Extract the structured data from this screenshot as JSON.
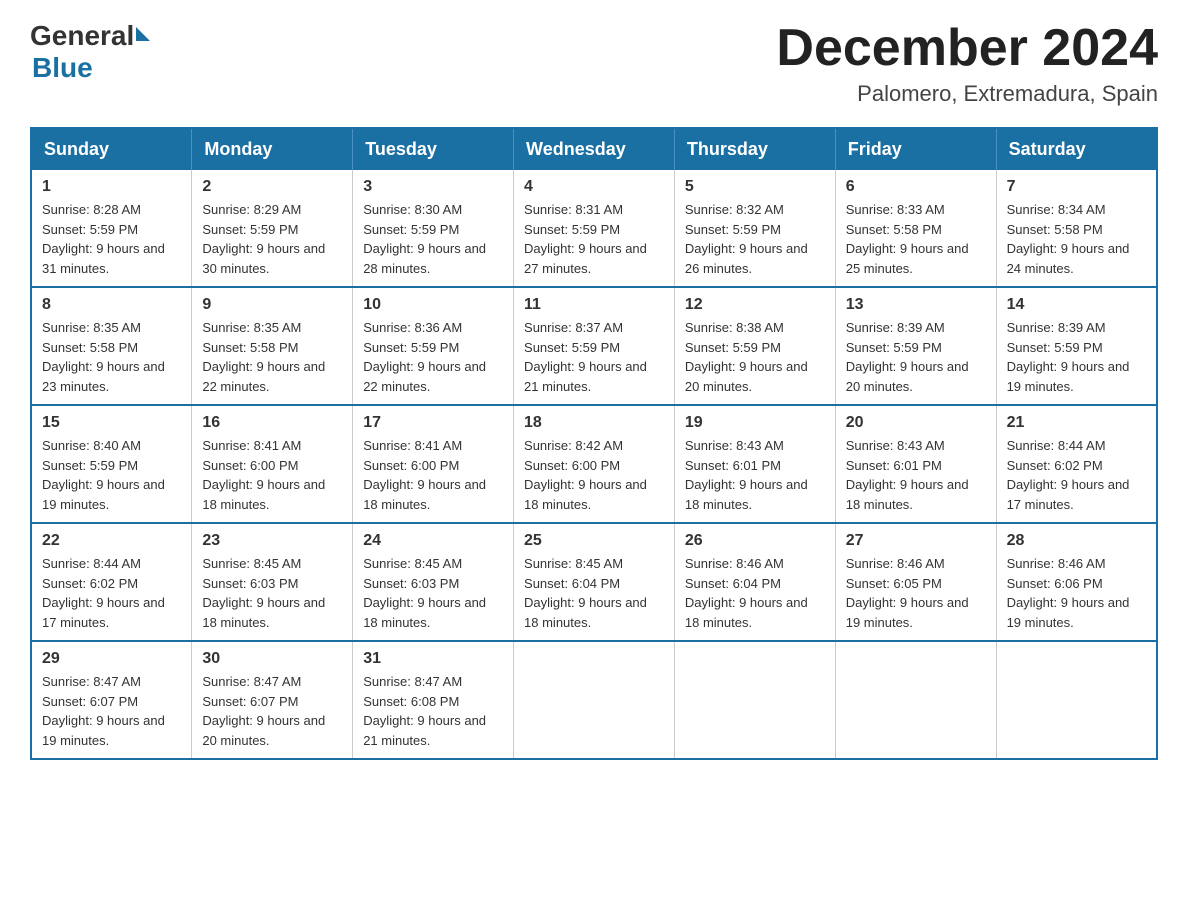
{
  "header": {
    "logo_general": "General",
    "logo_blue": "Blue",
    "month_title": "December 2024",
    "location": "Palomero, Extremadura, Spain"
  },
  "calendar": {
    "headers": [
      "Sunday",
      "Monday",
      "Tuesday",
      "Wednesday",
      "Thursday",
      "Friday",
      "Saturday"
    ],
    "weeks": [
      [
        {
          "day": "1",
          "sunrise": "8:28 AM",
          "sunset": "5:59 PM",
          "daylight": "9 hours and 31 minutes."
        },
        {
          "day": "2",
          "sunrise": "8:29 AM",
          "sunset": "5:59 PM",
          "daylight": "9 hours and 30 minutes."
        },
        {
          "day": "3",
          "sunrise": "8:30 AM",
          "sunset": "5:59 PM",
          "daylight": "9 hours and 28 minutes."
        },
        {
          "day": "4",
          "sunrise": "8:31 AM",
          "sunset": "5:59 PM",
          "daylight": "9 hours and 27 minutes."
        },
        {
          "day": "5",
          "sunrise": "8:32 AM",
          "sunset": "5:59 PM",
          "daylight": "9 hours and 26 minutes."
        },
        {
          "day": "6",
          "sunrise": "8:33 AM",
          "sunset": "5:58 PM",
          "daylight": "9 hours and 25 minutes."
        },
        {
          "day": "7",
          "sunrise": "8:34 AM",
          "sunset": "5:58 PM",
          "daylight": "9 hours and 24 minutes."
        }
      ],
      [
        {
          "day": "8",
          "sunrise": "8:35 AM",
          "sunset": "5:58 PM",
          "daylight": "9 hours and 23 minutes."
        },
        {
          "day": "9",
          "sunrise": "8:35 AM",
          "sunset": "5:58 PM",
          "daylight": "9 hours and 22 minutes."
        },
        {
          "day": "10",
          "sunrise": "8:36 AM",
          "sunset": "5:59 PM",
          "daylight": "9 hours and 22 minutes."
        },
        {
          "day": "11",
          "sunrise": "8:37 AM",
          "sunset": "5:59 PM",
          "daylight": "9 hours and 21 minutes."
        },
        {
          "day": "12",
          "sunrise": "8:38 AM",
          "sunset": "5:59 PM",
          "daylight": "9 hours and 20 minutes."
        },
        {
          "day": "13",
          "sunrise": "8:39 AM",
          "sunset": "5:59 PM",
          "daylight": "9 hours and 20 minutes."
        },
        {
          "day": "14",
          "sunrise": "8:39 AM",
          "sunset": "5:59 PM",
          "daylight": "9 hours and 19 minutes."
        }
      ],
      [
        {
          "day": "15",
          "sunrise": "8:40 AM",
          "sunset": "5:59 PM",
          "daylight": "9 hours and 19 minutes."
        },
        {
          "day": "16",
          "sunrise": "8:41 AM",
          "sunset": "6:00 PM",
          "daylight": "9 hours and 18 minutes."
        },
        {
          "day": "17",
          "sunrise": "8:41 AM",
          "sunset": "6:00 PM",
          "daylight": "9 hours and 18 minutes."
        },
        {
          "day": "18",
          "sunrise": "8:42 AM",
          "sunset": "6:00 PM",
          "daylight": "9 hours and 18 minutes."
        },
        {
          "day": "19",
          "sunrise": "8:43 AM",
          "sunset": "6:01 PM",
          "daylight": "9 hours and 18 minutes."
        },
        {
          "day": "20",
          "sunrise": "8:43 AM",
          "sunset": "6:01 PM",
          "daylight": "9 hours and 18 minutes."
        },
        {
          "day": "21",
          "sunrise": "8:44 AM",
          "sunset": "6:02 PM",
          "daylight": "9 hours and 17 minutes."
        }
      ],
      [
        {
          "day": "22",
          "sunrise": "8:44 AM",
          "sunset": "6:02 PM",
          "daylight": "9 hours and 17 minutes."
        },
        {
          "day": "23",
          "sunrise": "8:45 AM",
          "sunset": "6:03 PM",
          "daylight": "9 hours and 18 minutes."
        },
        {
          "day": "24",
          "sunrise": "8:45 AM",
          "sunset": "6:03 PM",
          "daylight": "9 hours and 18 minutes."
        },
        {
          "day": "25",
          "sunrise": "8:45 AM",
          "sunset": "6:04 PM",
          "daylight": "9 hours and 18 minutes."
        },
        {
          "day": "26",
          "sunrise": "8:46 AM",
          "sunset": "6:04 PM",
          "daylight": "9 hours and 18 minutes."
        },
        {
          "day": "27",
          "sunrise": "8:46 AM",
          "sunset": "6:05 PM",
          "daylight": "9 hours and 19 minutes."
        },
        {
          "day": "28",
          "sunrise": "8:46 AM",
          "sunset": "6:06 PM",
          "daylight": "9 hours and 19 minutes."
        }
      ],
      [
        {
          "day": "29",
          "sunrise": "8:47 AM",
          "sunset": "6:07 PM",
          "daylight": "9 hours and 19 minutes."
        },
        {
          "day": "30",
          "sunrise": "8:47 AM",
          "sunset": "6:07 PM",
          "daylight": "9 hours and 20 minutes."
        },
        {
          "day": "31",
          "sunrise": "8:47 AM",
          "sunset": "6:08 PM",
          "daylight": "9 hours and 21 minutes."
        },
        null,
        null,
        null,
        null
      ]
    ]
  }
}
